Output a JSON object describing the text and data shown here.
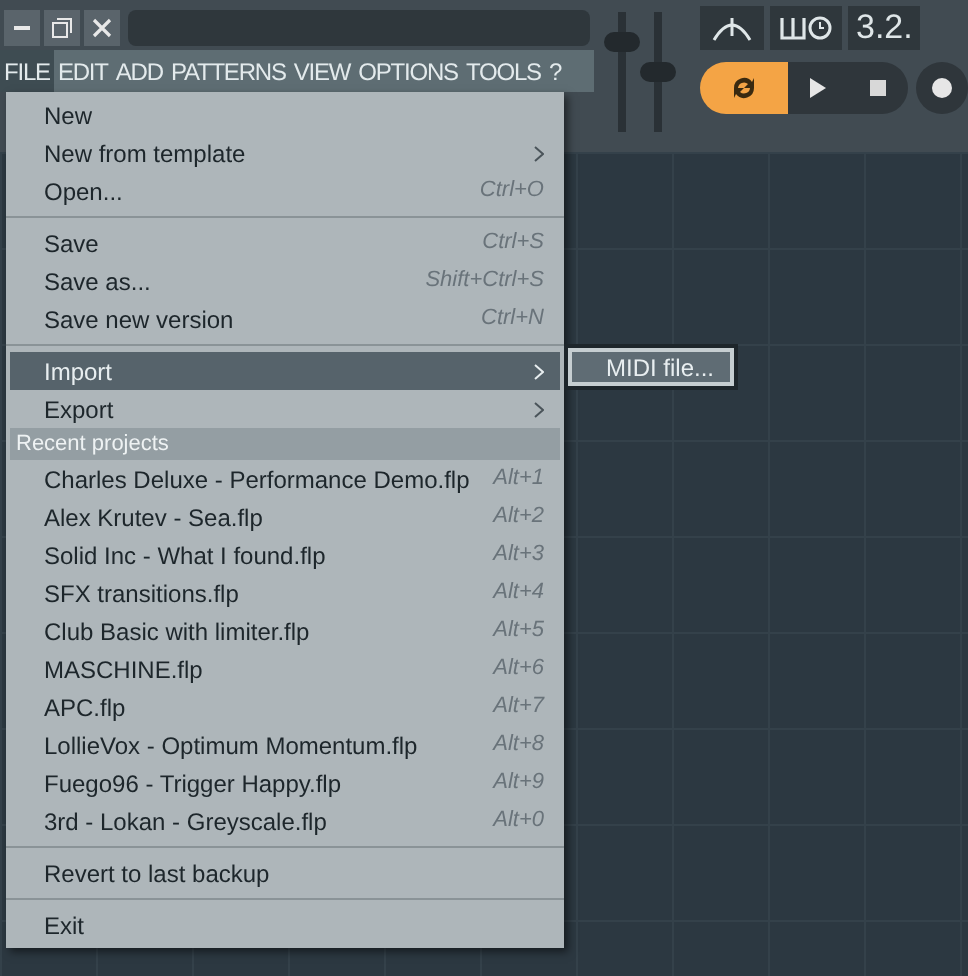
{
  "menu_bar": [
    {
      "label": "FILE",
      "selected": true
    },
    {
      "label": "EDIT",
      "selected": false
    },
    {
      "label": "ADD",
      "selected": false
    },
    {
      "label": "PATTERNS",
      "selected": false
    },
    {
      "label": "VIEW",
      "selected": false
    },
    {
      "label": "OPTIONS",
      "selected": false
    },
    {
      "label": "TOOLS",
      "selected": false
    },
    {
      "label": "?",
      "selected": false
    }
  ],
  "sliders": [
    {
      "level": 0.8
    },
    {
      "level": 0.5
    }
  ],
  "tempo_display": "3.2.",
  "transport": [
    {
      "kind": "loop",
      "on": true
    },
    {
      "kind": "play",
      "on": false
    },
    {
      "kind": "stop",
      "on": false
    },
    {
      "kind": "record",
      "on": false
    }
  ],
  "file_menu": [
    {
      "kind": "item",
      "label": "New",
      "selected": false
    },
    {
      "kind": "item",
      "label": "New from template",
      "submenu": true,
      "selected": false
    },
    {
      "kind": "item",
      "label": "Open...",
      "shortcut": "Ctrl+O",
      "selected": false
    },
    {
      "kind": "separator"
    },
    {
      "kind": "item",
      "label": "Save",
      "shortcut": "Ctrl+S",
      "selected": false
    },
    {
      "kind": "item",
      "label": "Save as...",
      "shortcut": "Shift+Ctrl+S",
      "selected": false
    },
    {
      "kind": "item",
      "label": "Save new version",
      "shortcut": "Ctrl+N",
      "selected": false
    },
    {
      "kind": "separator"
    },
    {
      "kind": "item",
      "label": "Import",
      "submenu": true,
      "selected": true
    },
    {
      "kind": "item",
      "label": "Export",
      "submenu": true,
      "selected": false
    },
    {
      "kind": "header",
      "label": "Recent projects"
    },
    {
      "kind": "item",
      "label": "Charles Deluxe - Performance Demo.flp",
      "shortcut": "Alt+1",
      "selected": false
    },
    {
      "kind": "item",
      "label": "Alex Krutev - Sea.flp",
      "shortcut": "Alt+2",
      "selected": false
    },
    {
      "kind": "item",
      "label": "Solid Inc - What I found.flp",
      "shortcut": "Alt+3",
      "selected": false
    },
    {
      "kind": "item",
      "label": "SFX transitions.flp",
      "shortcut": "Alt+4",
      "selected": false
    },
    {
      "kind": "item",
      "label": "Club Basic with limiter.flp",
      "shortcut": "Alt+5",
      "selected": false
    },
    {
      "kind": "item",
      "label": "MASCHINE.flp",
      "shortcut": "Alt+6",
      "selected": false
    },
    {
      "kind": "item",
      "label": "APC.flp",
      "shortcut": "Alt+7",
      "selected": false
    },
    {
      "kind": "item",
      "label": "LollieVox - Optimum Momentum.flp",
      "shortcut": "Alt+8",
      "selected": false
    },
    {
      "kind": "item",
      "label": "Fuego96 - Trigger Happy.flp",
      "shortcut": "Alt+9",
      "selected": false
    },
    {
      "kind": "item",
      "label": "3rd - Lokan - Greyscale.flp",
      "shortcut": "Alt+0",
      "selected": false
    },
    {
      "kind": "separator"
    },
    {
      "kind": "item",
      "label": "Revert to last backup",
      "selected": false
    },
    {
      "kind": "separator"
    },
    {
      "kind": "item",
      "label": "Exit",
      "selected": false
    }
  ],
  "import_submenu": [
    {
      "label": "MIDI file...",
      "selected": true
    }
  ]
}
